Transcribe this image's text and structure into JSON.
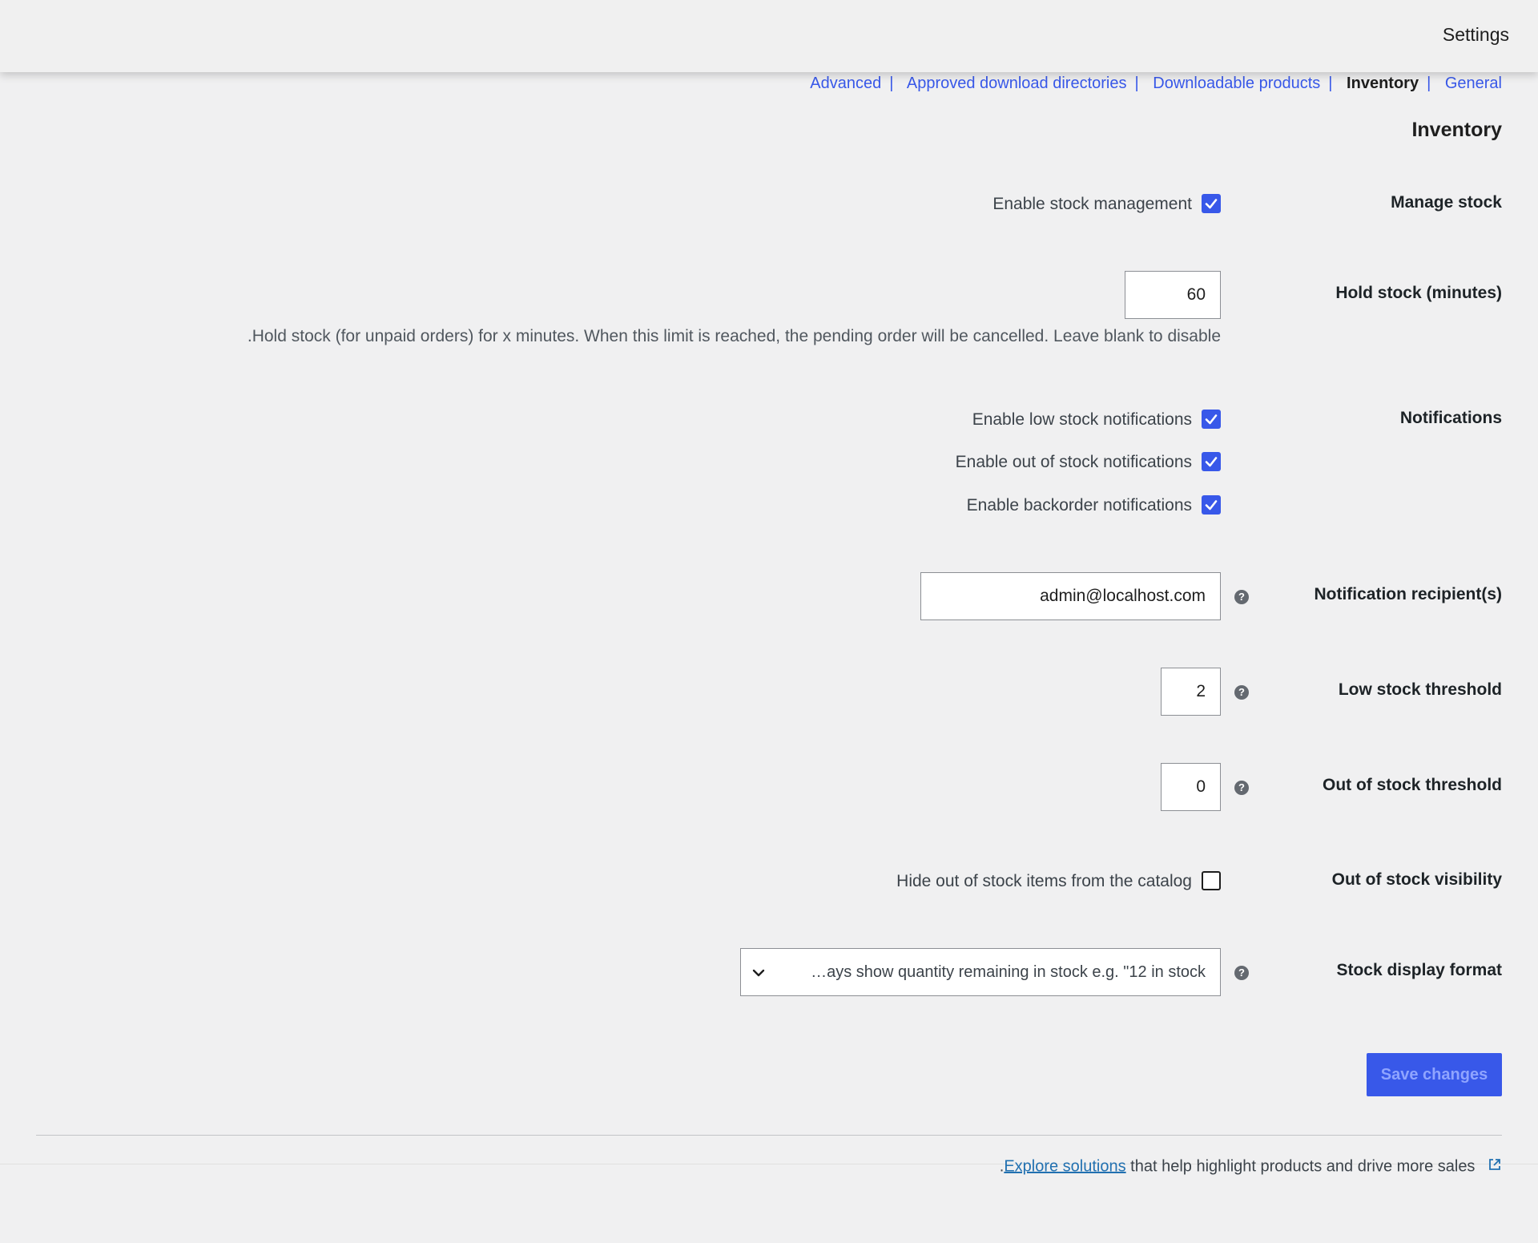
{
  "topbar": {
    "title": "Settings"
  },
  "subnav": {
    "items": [
      {
        "label": "Advanced"
      },
      {
        "label": "Approved download directories"
      },
      {
        "label": "Downloadable products"
      },
      {
        "label": "Inventory"
      },
      {
        "label": "General"
      }
    ],
    "separator": "|"
  },
  "section": {
    "title": "Inventory"
  },
  "manage_stock": {
    "label": "Manage stock",
    "checkbox_label": "Enable stock management",
    "checked": true
  },
  "hold_stock": {
    "label": "Hold stock (minutes)",
    "value": "60",
    "description": ".Hold stock (for unpaid orders) for x minutes. When this limit is reached, the pending order will be cancelled. Leave blank to disable"
  },
  "notifications": {
    "label": "Notifications",
    "options": [
      {
        "label": "Enable low stock notifications",
        "checked": true
      },
      {
        "label": "Enable out of stock notifications",
        "checked": true
      },
      {
        "label": "Enable backorder notifications",
        "checked": true
      }
    ]
  },
  "notification_recipient": {
    "label": "Notification recipient(s)",
    "value": "admin@localhost.com"
  },
  "low_stock_threshold": {
    "label": "Low stock threshold",
    "value": "2"
  },
  "out_of_stock_threshold": {
    "label": "Out of stock threshold",
    "value": "0"
  },
  "out_of_stock_visibility": {
    "label": "Out of stock visibility",
    "checkbox_label": "Hide out of stock items from the catalog",
    "checked": false
  },
  "stock_display_format": {
    "label": "Stock display format",
    "selected": "…ays show quantity remaining in stock e.g. \"12 in stock"
  },
  "actions": {
    "save_label": "Save changes"
  },
  "footer": {
    "prefix": ".",
    "link_text": "Explore solutions",
    "text": " that help highlight products and drive more sales"
  },
  "colors": {
    "accent": "#3858e9",
    "background": "#f0f0f1",
    "text": "#1e1e1e"
  }
}
